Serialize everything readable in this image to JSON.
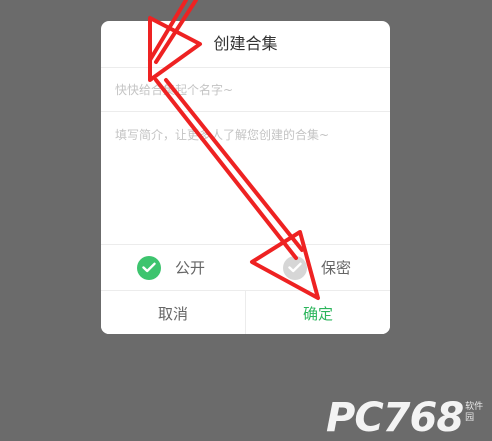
{
  "dialog": {
    "title": "创建合集",
    "name_field": {
      "placeholder": "快快给合集起个名字~",
      "value": ""
    },
    "description_field": {
      "placeholder": "填写简介，让更多人了解您创建的合集~",
      "value": ""
    },
    "privacy": {
      "options": [
        {
          "label": "公开",
          "selected": true
        },
        {
          "label": "保密",
          "selected": false
        }
      ]
    },
    "buttons": {
      "cancel": "取消",
      "confirm": "确定"
    }
  },
  "colors": {
    "accent": "#3dc46e",
    "confirm_text": "#2cb55c",
    "annotation_arrow": "#ee2222",
    "overlay": "#6b6b6b"
  },
  "watermark": {
    "main": "PC768",
    "sub": "软件园"
  }
}
